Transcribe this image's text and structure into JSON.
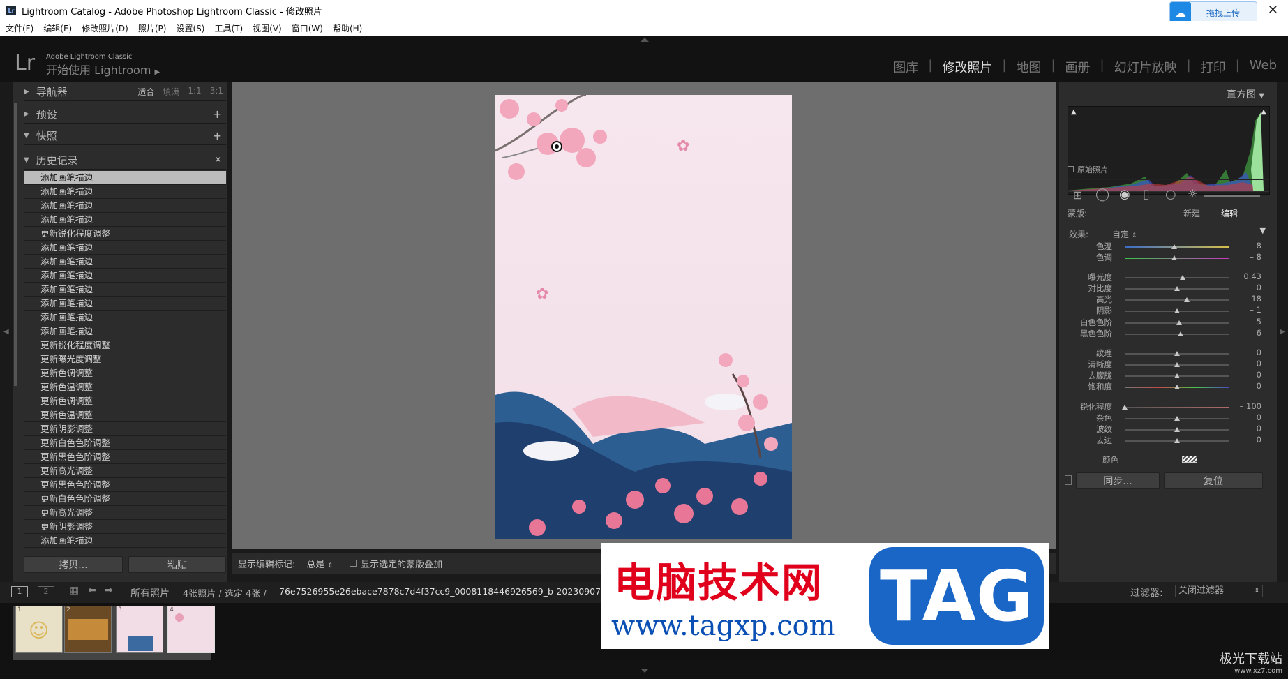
{
  "window": {
    "title": "Lightroom Catalog - Adobe Photoshop Lightroom Classic - 修改照片",
    "app_icon": "Lr",
    "upload_label": "拖拽上传",
    "close_glyph": "✕"
  },
  "menu": [
    "文件(F)",
    "编辑(E)",
    "修改照片(D)",
    "照片(P)",
    "设置(S)",
    "工具(T)",
    "视图(V)",
    "窗口(W)",
    "帮助(H)"
  ],
  "identity": {
    "logo": "Lr",
    "brand": "Adobe Lightroom Classic",
    "tagline": "开始使用 Lightroom",
    "arrow": "▶"
  },
  "modules": [
    "图库",
    "修改照片",
    "地图",
    "画册",
    "幻灯片放映",
    "打印",
    "Web"
  ],
  "active_module": "修改照片",
  "left": {
    "navigator": {
      "label": "导航器",
      "fit": "适合",
      "fill": "填满",
      "z1": "1:1",
      "z3": "3:1"
    },
    "presets": {
      "label": "预设",
      "add": "+"
    },
    "snapshots": {
      "label": "快照",
      "add": "+"
    },
    "history": {
      "label": "历史记录",
      "clear": "✕",
      "items": [
        "添加画笔描边",
        "添加画笔描边",
        "添加画笔描边",
        "添加画笔描边",
        "更新锐化程度调整",
        "添加画笔描边",
        "添加画笔描边",
        "添加画笔描边",
        "添加画笔描边",
        "添加画笔描边",
        "添加画笔描边",
        "添加画笔描边",
        "更新锐化程度调整",
        "更新曝光度调整",
        "更新色调调整",
        "更新色温调整",
        "更新色调调整",
        "更新色温调整",
        "更新阴影调整",
        "更新白色色阶调整",
        "更新黑色色阶调整",
        "更新高光调整",
        "更新黑色色阶调整",
        "更新白色色阶调整",
        "更新高光调整",
        "更新阴影调整",
        "添加画笔描边"
      ]
    },
    "copy_button": "拷贝...",
    "paste_button": "粘贴"
  },
  "center_toolbar": {
    "show_edit_label": "显示编辑标记:",
    "show_edit_value": "总是",
    "show_overlay_label": "显示选定的蒙版叠加"
  },
  "right": {
    "histogram_label": "直方图",
    "original_photo": "原始照片",
    "mask_label": "蒙版:",
    "mask_new": "新建",
    "mask_edit": "编辑",
    "effect_label": "效果:",
    "effect_value": "自定",
    "sliders": [
      {
        "label": "色温",
        "value": "– 8",
        "pos": 0.47
      },
      {
        "label": "色调",
        "value": "– 8",
        "pos": 0.47
      },
      {
        "label": "曝光度",
        "value": "0.43",
        "pos": 0.55
      },
      {
        "label": "对比度",
        "value": "0",
        "pos": 0.5
      },
      {
        "label": "高光",
        "value": "18",
        "pos": 0.59
      },
      {
        "label": "阴影",
        "value": "– 1",
        "pos": 0.5
      },
      {
        "label": "白色色阶",
        "value": "5",
        "pos": 0.52
      },
      {
        "label": "黑色色阶",
        "value": "6",
        "pos": 0.53
      },
      {
        "label": "纹理",
        "value": "0",
        "pos": 0.5
      },
      {
        "label": "清晰度",
        "value": "0",
        "pos": 0.5
      },
      {
        "label": "去朦胧",
        "value": "0",
        "pos": 0.5
      },
      {
        "label": "饱和度",
        "value": "0",
        "pos": 0.5
      },
      {
        "label": "锐化程度",
        "value": "– 100",
        "pos": 0.0
      },
      {
        "label": "杂色",
        "value": "0",
        "pos": 0.5
      },
      {
        "label": "波纹",
        "value": "0",
        "pos": 0.5
      },
      {
        "label": "去边",
        "value": "0",
        "pos": 0.5
      }
    ],
    "color_label": "颜色",
    "sync_button": "同步...",
    "reset_button": "复位"
  },
  "filmbar": {
    "view1": "1",
    "view2": "2",
    "source": "所有照片",
    "count": "4张照片 / 选定 4张 /",
    "filename": "76e7526955e26ebace7878c7d4f37cc9_0008118446926569_b-20230907170150-x6cpn94.jpg",
    "filter_label": "过滤器:",
    "filter_value": "关闭过滤器"
  },
  "thumbs": [
    "1",
    "2",
    "3",
    "4"
  ],
  "watermark": {
    "cn": "电脑技术网",
    "url": "www.tagxp.com",
    "tag": "TAG",
    "corner": "极光下载站",
    "corner_url": "www.xz7.com"
  },
  "colors": {
    "accent": "#1a66c7",
    "red": "#e0001b",
    "panel": "#2c2c2c",
    "canvas": "#6e6e6e"
  }
}
